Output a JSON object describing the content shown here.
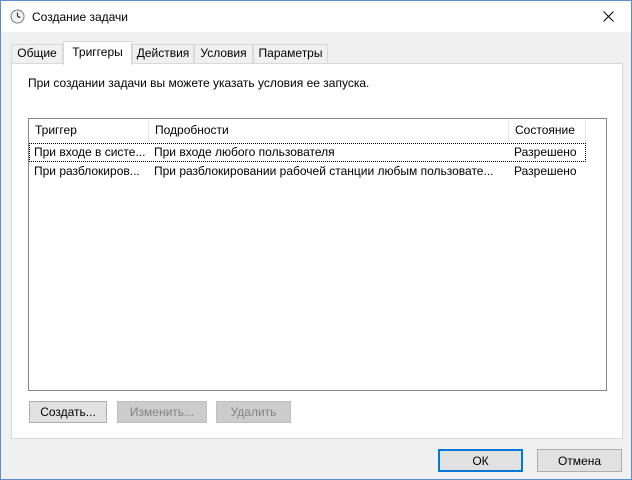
{
  "window": {
    "title": "Создание задачи"
  },
  "tabs": [
    {
      "label": "Общие"
    },
    {
      "label": "Триггеры"
    },
    {
      "label": "Действия"
    },
    {
      "label": "Условия"
    },
    {
      "label": "Параметры"
    }
  ],
  "active_tab": "Триггеры",
  "panel": {
    "info": "При создании задачи вы можете указать условия ее запуска."
  },
  "triggers_list": {
    "columns": [
      "Триггер",
      "Подробности",
      "Состояние"
    ],
    "rows": [
      {
        "trigger": "При входе в систе...",
        "details": "При входе любого пользователя",
        "state": "Разрешено",
        "selected": true
      },
      {
        "trigger": "При разблокиров...",
        "details": "При разблокировании рабочей станции любым пользовате...",
        "state": "Разрешено",
        "selected": false
      }
    ]
  },
  "list_buttons": {
    "create": "Создать...",
    "edit": "Изменить...",
    "delete": "Удалить"
  },
  "dialog_buttons": {
    "ok": "ОК",
    "cancel": "Отмена"
  },
  "colors": {
    "accent": "#0078d7",
    "window_border": "#5a8fc8",
    "face": "#f0f0f0"
  },
  "icons": {
    "title": "clock-icon",
    "close": "close-icon"
  }
}
